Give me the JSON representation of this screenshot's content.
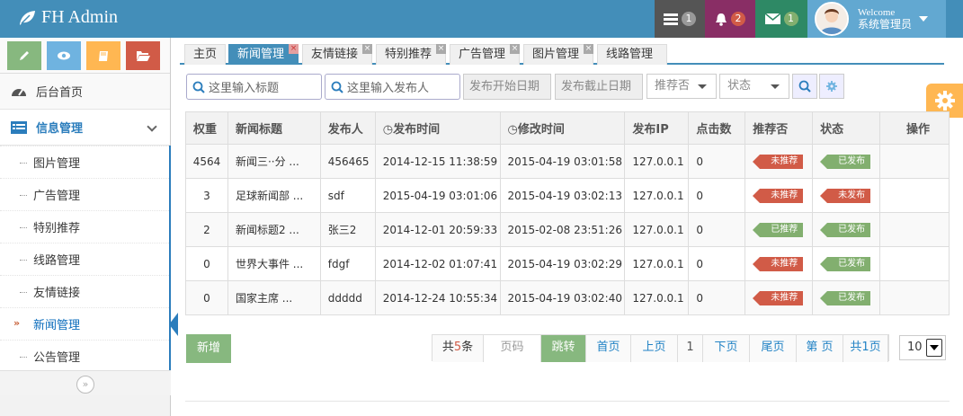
{
  "brand": {
    "name": "FH Admin",
    "icon": "leaf-icon"
  },
  "navbar": {
    "tasks": {
      "icon": "tasks-icon",
      "count": "1",
      "bg": "#555555",
      "badge_bg": "#999999"
    },
    "notifications": {
      "icon": "bell-icon",
      "count": "2",
      "bg": "#892e65",
      "badge_bg": "#d15b47"
    },
    "messages": {
      "icon": "envelope-icon",
      "count": "1",
      "bg": "#2e8965",
      "badge_bg": "#82af6f"
    },
    "user": {
      "welcome": "Welcome",
      "name": "系统管理员"
    }
  },
  "sidebar": {
    "shortcuts": [
      {
        "icon": "pencil-icon",
        "color": "#87b87f"
      },
      {
        "icon": "eye-icon",
        "color": "#6fb3e0"
      },
      {
        "icon": "book-icon",
        "color": "#ffb752"
      },
      {
        "icon": "folder-icon",
        "color": "#d15b47"
      }
    ],
    "home": "后台首页",
    "group": "信息管理",
    "items": [
      {
        "label": "图片管理"
      },
      {
        "label": "广告管理"
      },
      {
        "label": "特别推荐"
      },
      {
        "label": "线路管理"
      },
      {
        "label": "友情链接"
      },
      {
        "label": "新闻管理"
      },
      {
        "label": "公告管理"
      }
    ],
    "active_item": "新闻管理"
  },
  "tabs": [
    {
      "label": "主页"
    },
    {
      "label": "新闻管理"
    },
    {
      "label": "友情链接"
    },
    {
      "label": "特别推荐"
    },
    {
      "label": "广告管理"
    },
    {
      "label": "图片管理"
    },
    {
      "label": "线路管理"
    }
  ],
  "toolbar": {
    "title_placeholder": "这里输入标题",
    "author_placeholder": "这里输入发布人",
    "start_date": "发布开始日期",
    "end_date": "发布截止日期",
    "recommend_select": "推荐否",
    "status_select": "状态"
  },
  "table": {
    "headers": [
      "权重",
      "新闻标题",
      "发布人",
      "发布时间",
      "修改时间",
      "发布IP",
      "点击数",
      "推荐否",
      "状态",
      "操作"
    ],
    "rows": [
      {
        "weight": "4564",
        "title": "新闻三··分 ...",
        "author": "456465",
        "published": "2014-12-15 11:38:59",
        "modified": "2015-04-19 03:01:58",
        "ip": "127.0.0.1",
        "clicks": "0",
        "recommend": "未推荐",
        "status": "已发布"
      },
      {
        "weight": "3",
        "title": "足球新闻部 ...",
        "author": "sdf",
        "published": "2015-04-19 03:01:06",
        "modified": "2015-04-19 03:02:13",
        "ip": "127.0.0.1",
        "clicks": "0",
        "recommend": "未推荐",
        "status": "未发布"
      },
      {
        "weight": "2",
        "title": "新闻标题2 ...",
        "author": "张三2",
        "published": "2014-12-01 20:59:33",
        "modified": "2015-02-08 23:51:26",
        "ip": "127.0.0.1",
        "clicks": "0",
        "recommend": "已推荐",
        "status": "已发布"
      },
      {
        "weight": "0",
        "title": "世界大事件 ...",
        "author": "fdgf",
        "published": "2014-12-02 01:07:41",
        "modified": "2015-04-19 03:02:29",
        "ip": "127.0.0.1",
        "clicks": "0",
        "recommend": "未推荐",
        "status": "已发布"
      },
      {
        "weight": "0",
        "title": "国家主席 ...",
        "author": "ddddd",
        "published": "2014-12-24 10:55:34",
        "modified": "2015-04-19 03:02:40",
        "ip": "127.0.0.1",
        "clicks": "0",
        "recommend": "未推荐",
        "status": "已发布"
      }
    ]
  },
  "actions": {
    "add": "新增"
  },
  "pager": {
    "total_prefix": "共",
    "total": "5",
    "total_suffix": "条",
    "page_placeholder": "页码",
    "jump": "跳转",
    "first": "首页",
    "prev": "上页",
    "current": "1",
    "next": "下页",
    "last": "尾页",
    "nth": "第 页",
    "pages": "共1页",
    "page_size": "10"
  },
  "colors": {
    "primary": "#438eb9",
    "success": "#82af6f",
    "danger": "#d15b47",
    "warning": "#ffb752"
  }
}
